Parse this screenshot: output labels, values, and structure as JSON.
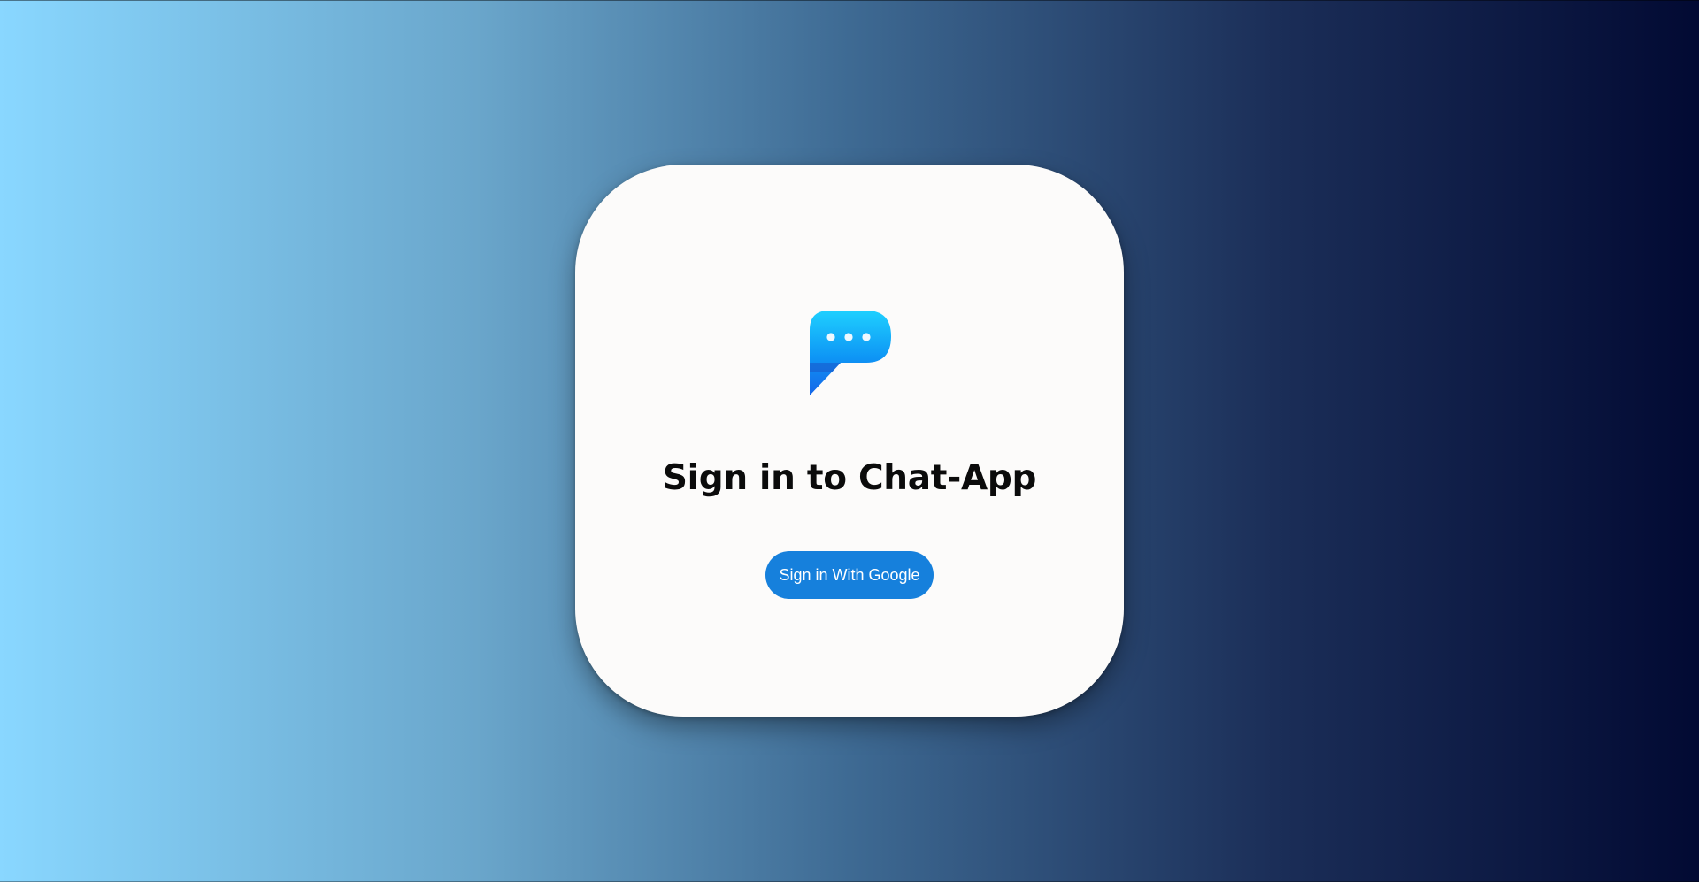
{
  "app": {
    "logo_icon": "chat-bubble-icon"
  },
  "login": {
    "title": "Sign in to Chat-App",
    "google_button_label": "Sign in With Google"
  },
  "colors": {
    "button": "#1680dc",
    "card": "#fcfbfa",
    "background_start": "#89d7ff",
    "background_end": "#020a33",
    "logo_top": "#1fd0ff",
    "logo_bottom": "#1565e8"
  }
}
